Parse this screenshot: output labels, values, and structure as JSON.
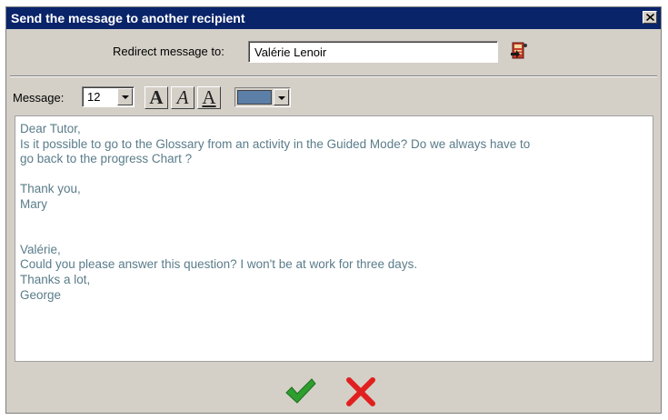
{
  "window": {
    "title": "Send the message to another recipient"
  },
  "recipient": {
    "label": "Redirect message to:",
    "value": "Valérie Lenoir"
  },
  "toolbar": {
    "message_label": "Message:",
    "font_size": "12",
    "bold_label": "A",
    "italic_label": "A",
    "underline_label": "A",
    "text_color": "#5c7fa8"
  },
  "message": {
    "lines": [
      "Dear Tutor,",
      "Is it possible to go to the Glossary from an activity in the Guided Mode? Do we always have to",
      "go back to the progress Chart ?",
      "",
      "Thank you,",
      "Mary",
      "",
      "",
      "Valérie,",
      "Could you please answer this question? I won't be at work for three days.",
      "Thanks a lot,",
      "George"
    ]
  },
  "colors": {
    "titlebar": "#0a246a",
    "ok": "#2e9e2e",
    "cancel": "#e02020"
  },
  "icons": {
    "close": "close-icon",
    "address_book": "address-book-icon",
    "ok": "checkmark-icon",
    "cancel": "x-icon"
  }
}
